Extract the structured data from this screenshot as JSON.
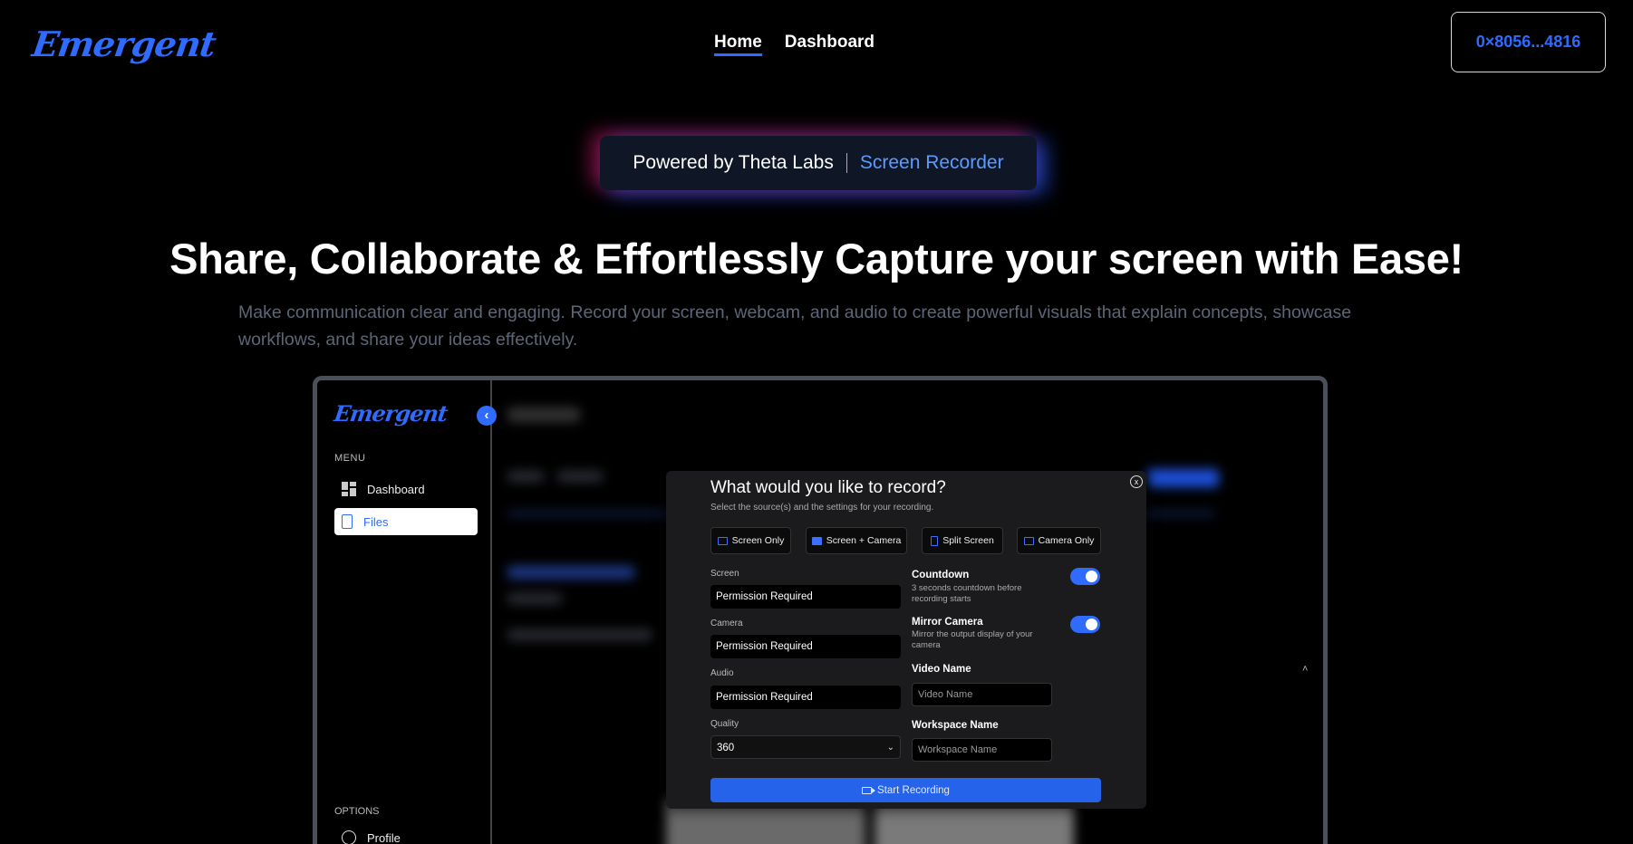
{
  "brand": {
    "logo_text": "Emergent",
    "accent_color": "#2f6bff"
  },
  "nav": {
    "home": "Home",
    "dashboard": "Dashboard"
  },
  "wallet": {
    "address": "0×8056...4816"
  },
  "badge": {
    "left": "Powered by Theta Labs",
    "right": "Screen Recorder"
  },
  "hero": {
    "headline": "Share, Collaborate & Effortlessly Capture your screen with Ease!",
    "subtext": "Make communication clear and engaging. Record your screen, webcam, and audio to create powerful visuals that explain concepts, showcase workflows, and share your ideas effectively."
  },
  "app": {
    "logo_text": "Emergent",
    "collapse_icon": "arrow-left-icon",
    "menu_label": "MENU",
    "menu": [
      {
        "label": "Dashboard",
        "icon": "grid-icon"
      },
      {
        "label": "Files",
        "icon": "file-icon"
      }
    ],
    "options_label": "OPTIONS",
    "profile": {
      "label": "Profile",
      "icon": "user-circle-icon"
    }
  },
  "modal": {
    "title": "What would you like to record?",
    "subtitle": "Select the source(s) and the settings for your recording.",
    "close": "x",
    "sources": [
      "Screen Only",
      "Screen + Camera",
      "Split Screen",
      "Camera Only"
    ],
    "screen": {
      "label": "Screen",
      "value": "Permission Required"
    },
    "camera": {
      "label": "Camera",
      "value": "Permission Required"
    },
    "audio": {
      "label": "Audio",
      "value": "Permission Required"
    },
    "quality": {
      "label": "Quality",
      "value": "360"
    },
    "countdown": {
      "title": "Countdown",
      "desc": "3 seconds countdown before recording starts",
      "enabled": true
    },
    "mirror": {
      "title": "Mirror Camera",
      "desc": "Mirror the output display of your camera",
      "enabled": true
    },
    "video_name": {
      "label": "Video Name",
      "placeholder": "Video Name"
    },
    "workspace_name": {
      "label": "Workspace Name",
      "placeholder": "Workspace Name"
    },
    "start": "Start Recording"
  }
}
